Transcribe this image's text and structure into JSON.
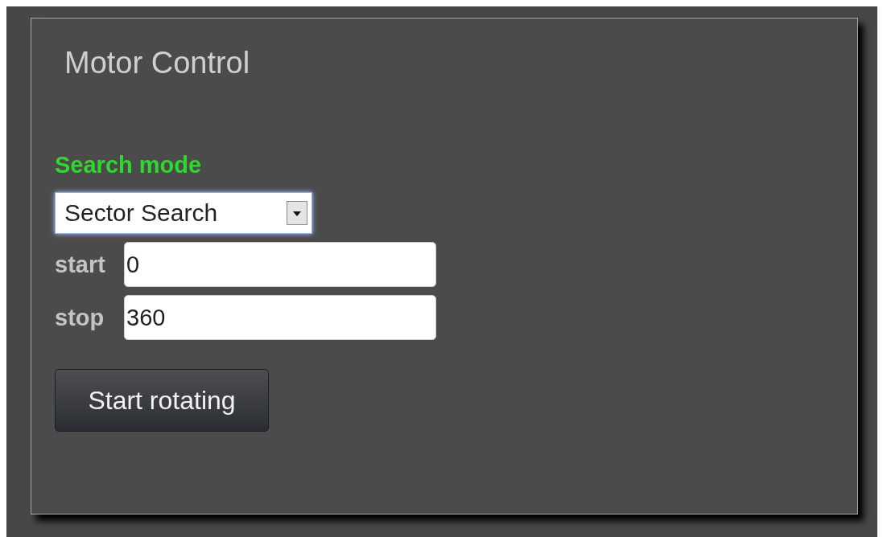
{
  "panel": {
    "title": "Motor Control"
  },
  "search_mode": {
    "label": "Search mode",
    "value": "Sector Search"
  },
  "fields": [
    {
      "label": "start",
      "value": "0"
    },
    {
      "label": "stop",
      "value": "360"
    }
  ],
  "button": {
    "label": "Start rotating"
  }
}
